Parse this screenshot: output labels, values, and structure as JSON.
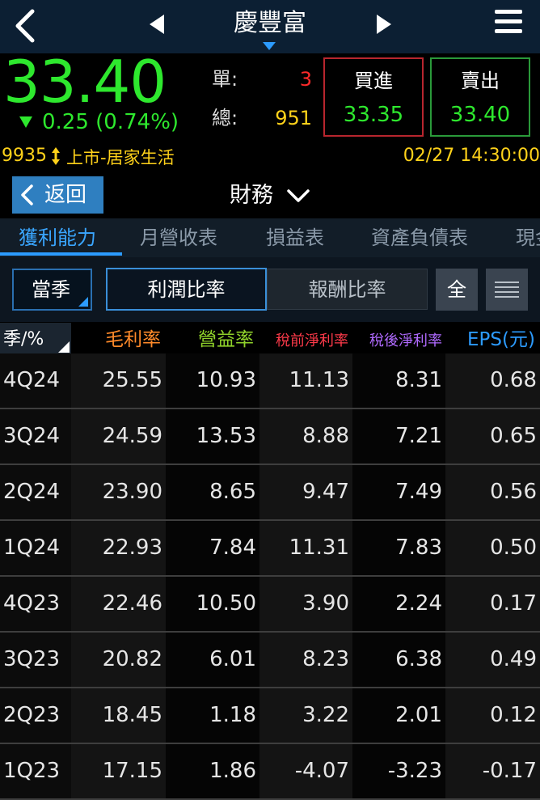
{
  "header": {
    "stock_name": "慶豐富"
  },
  "quote": {
    "price": "33.40",
    "change": "0.25 (0.74%)",
    "unit_label": "單:",
    "unit_value": "3",
    "total_label": "總:",
    "total_value": "951",
    "buy_label": "買進",
    "buy_price": "33.35",
    "sell_label": "賣出",
    "sell_price": "33.40",
    "code": "9935",
    "market_sector": "上市-居家生活",
    "datetime": "02/27 14:30:00"
  },
  "nav": {
    "return_label": "返回",
    "section_title": "財務"
  },
  "tabs": [
    {
      "label": "獲利能力",
      "active": true
    },
    {
      "label": "月營收表",
      "active": false
    },
    {
      "label": "損益表",
      "active": false
    },
    {
      "label": "資產負債表",
      "active": false
    },
    {
      "label": "現金流量表",
      "active": false
    }
  ],
  "controls": {
    "period": "當季",
    "segment_profit": "利潤比率",
    "segment_return": "報酬比率",
    "all_label": "全"
  },
  "table": {
    "headers": [
      {
        "label": "季/%",
        "color": "#ffffff"
      },
      {
        "label": "毛利率",
        "color": "#ff8a2a"
      },
      {
        "label": "營益率",
        "color": "#8fd12a"
      },
      {
        "label": "稅前淨利率",
        "color": "#ff3a4a"
      },
      {
        "label": "稅後淨利率",
        "color": "#b06aff"
      },
      {
        "label": "EPS(元)",
        "color": "#2c9bff"
      }
    ],
    "rows": [
      [
        "4Q24",
        "25.55",
        "10.93",
        "11.13",
        "8.31",
        "0.68"
      ],
      [
        "3Q24",
        "24.59",
        "13.53",
        "8.88",
        "7.21",
        "0.65"
      ],
      [
        "2Q24",
        "23.90",
        "8.65",
        "9.47",
        "7.49",
        "0.56"
      ],
      [
        "1Q24",
        "22.93",
        "7.84",
        "11.31",
        "7.83",
        "0.50"
      ],
      [
        "4Q23",
        "22.46",
        "10.50",
        "3.90",
        "2.24",
        "0.17"
      ],
      [
        "3Q23",
        "20.82",
        "6.01",
        "8.23",
        "6.38",
        "0.49"
      ],
      [
        "2Q23",
        "18.45",
        "1.18",
        "3.22",
        "2.01",
        "0.12"
      ],
      [
        "1Q23",
        "17.15",
        "1.86",
        "-4.07",
        "-3.23",
        "-0.17"
      ]
    ]
  },
  "colors": {
    "up": "#2ee82e",
    "down_red": "#ff2a2a",
    "accent": "#2c9bff",
    "yellow": "#ffd21a"
  }
}
